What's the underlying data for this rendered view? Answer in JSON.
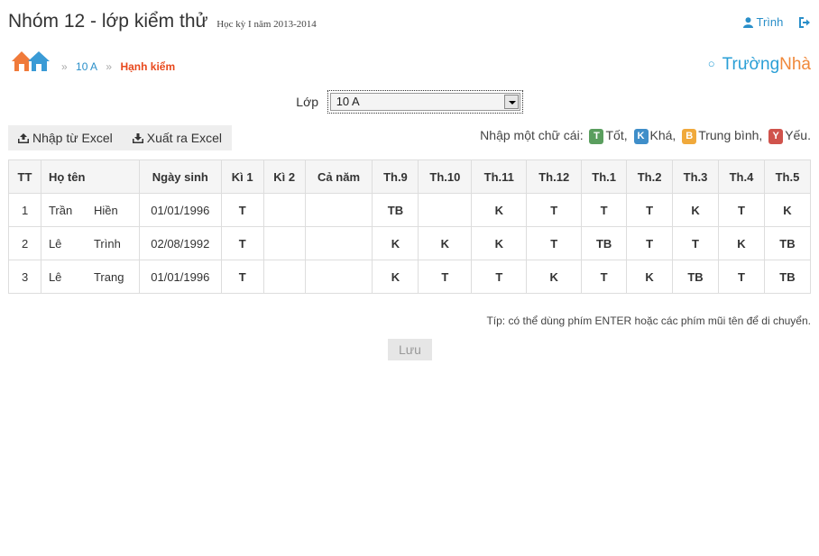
{
  "header": {
    "title": "Nhóm 12 - lớp kiểm thử",
    "subtitle": "Học kỳ I năm 2013-2014",
    "user_name": "Trình"
  },
  "breadcrumb": {
    "items": [
      "10 A",
      "Hạnh kiểm"
    ],
    "separator": "»"
  },
  "brand": {
    "part1": "Trường",
    "part2": "Nhà"
  },
  "class_select": {
    "label": "Lớp",
    "value": "10 A"
  },
  "toolbar": {
    "import_label": "Nhập từ Excel",
    "export_label": "Xuất ra Excel"
  },
  "legend": {
    "prompt": "Nhập một chữ cái:",
    "items": [
      {
        "letter": "T",
        "text": "Tốt,",
        "color": "#5a9e5e"
      },
      {
        "letter": "K",
        "text": "Khá,",
        "color": "#3f8ec9"
      },
      {
        "letter": "B",
        "text": "Trung bình,",
        "color": "#f0a93b"
      },
      {
        "letter": "Y",
        "text": "Yếu.",
        "color": "#d0534c"
      }
    ]
  },
  "table": {
    "headers": [
      "TT",
      "Họ tên",
      "Ngày sinh",
      "Kì 1",
      "Kì 2",
      "Cả năm",
      "Th.9",
      "Th.10",
      "Th.11",
      "Th.12",
      "Th.1",
      "Th.2",
      "Th.3",
      "Th.4",
      "Th.5"
    ],
    "rows": [
      {
        "tt": "1",
        "last": "Trần",
        "first": "Hiền",
        "dob": "01/01/1996",
        "ki1": "T",
        "ki2": "",
        "canam": "",
        "months": [
          "TB",
          "",
          "K",
          "T",
          "T",
          "T",
          "K",
          "T",
          "K"
        ]
      },
      {
        "tt": "2",
        "last": "Lê",
        "first": "Trình",
        "dob": "02/08/1992",
        "ki1": "T",
        "ki2": "",
        "canam": "",
        "months": [
          "K",
          "K",
          "K",
          "T",
          "TB",
          "T",
          "T",
          "K",
          "TB"
        ]
      },
      {
        "tt": "3",
        "last": "Lê",
        "first": "Trang",
        "dob": "01/01/1996",
        "ki1": "T",
        "ki2": "",
        "canam": "",
        "months": [
          "K",
          "T",
          "T",
          "K",
          "T",
          "K",
          "TB",
          "T",
          "TB"
        ]
      }
    ]
  },
  "tip": "Típ: có thể dùng phím ENTER hoặc các phím mũi tên để di chuyển.",
  "save_label": "Lưu"
}
